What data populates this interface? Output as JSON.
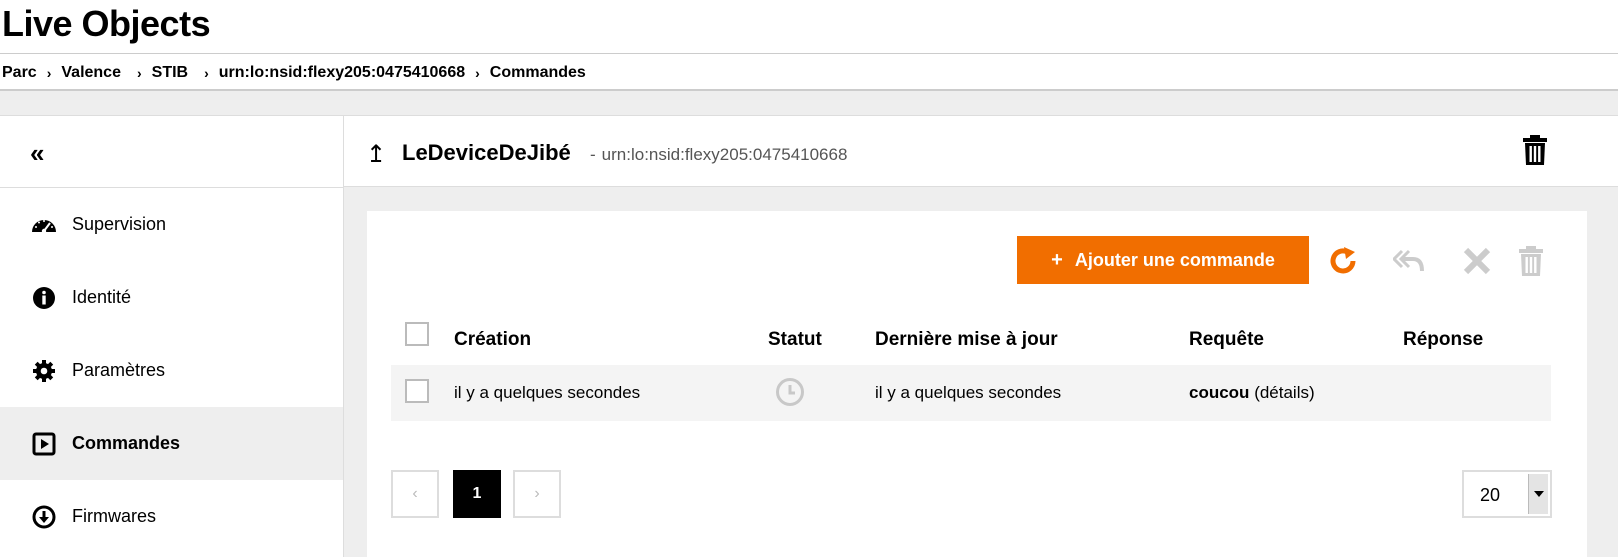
{
  "app": {
    "title": "Live Objects"
  },
  "breadcrumb": [
    {
      "label": "Parc"
    },
    {
      "label": "Valence"
    },
    {
      "label": "STIB"
    },
    {
      "label": "urn:lo:nsid:flexy205:0475410668"
    },
    {
      "label": "Commandes"
    }
  ],
  "breadcrumb_separator": "›",
  "sidebar": {
    "collapse_label": "«",
    "items": [
      {
        "label": "Supervision",
        "icon": "gauge-icon"
      },
      {
        "label": "Identité",
        "icon": "info-icon"
      },
      {
        "label": "Paramètres",
        "icon": "gear-icon"
      },
      {
        "label": "Commandes",
        "icon": "play-square-icon",
        "active": true
      },
      {
        "label": "Firmwares",
        "icon": "download-circle-icon"
      }
    ]
  },
  "device": {
    "back_label": "↥",
    "name": "LeDeviceDeJibé",
    "separator": "-",
    "urn": "urn:lo:nsid:flexy205:0475410668"
  },
  "toolbar": {
    "add_plus": "+",
    "add_label": "Ajouter une commande"
  },
  "table": {
    "columns": [
      "Création",
      "Statut",
      "Dernière mise à jour",
      "Requête",
      "Réponse"
    ],
    "rows": [
      {
        "creation": "il y a quelques secondes",
        "status_icon": "clock-icon",
        "last_update": "il y a quelques secondes",
        "request": "coucou",
        "request_details": "(détails)",
        "response": ""
      }
    ]
  },
  "pagination": {
    "prev": "‹",
    "current": "1",
    "next": "›",
    "page_size": "20"
  },
  "colors": {
    "accent": "#f16e00",
    "disabled_icon": "#cccccc",
    "active_bg": "#eeeeee"
  }
}
